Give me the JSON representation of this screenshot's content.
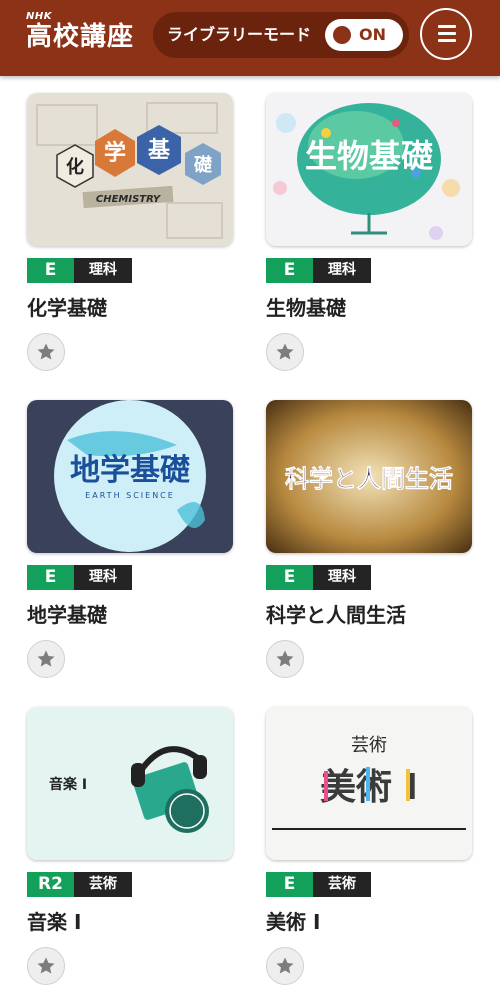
{
  "header": {
    "logo_small": "NHK",
    "logo_name": "高校講座",
    "mode_label": "ライブラリーモード",
    "toggle_state": "ON",
    "menu_icon": "hamburger-menu-icon"
  },
  "colors": {
    "header_bg": "#8c3216",
    "channel_badge": "#12a05a",
    "subject_badge": "#242424"
  },
  "programs": [
    {
      "title": "化学基礎",
      "channel": "E",
      "subject": "理科",
      "art_text": "化学基礎",
      "art_sub": "CHEMISTRY",
      "favorite_icon": "star-icon"
    },
    {
      "title": "生物基礎",
      "channel": "E",
      "subject": "理科",
      "art_text": "生物基礎",
      "favorite_icon": "star-icon"
    },
    {
      "title": "地学基礎",
      "channel": "E",
      "subject": "理科",
      "art_text": "地学基礎",
      "art_sub": "EARTH SCIENCE",
      "favorite_icon": "star-icon"
    },
    {
      "title": "科学と人間生活",
      "channel": "E",
      "subject": "理科",
      "art_text": "科学と人間生活",
      "favorite_icon": "star-icon"
    },
    {
      "title": "音楽 I",
      "channel": "R2",
      "subject": "芸術",
      "art_text": "音楽 I",
      "favorite_icon": "star-icon"
    },
    {
      "title": "美術 I",
      "channel": "E",
      "subject": "芸術",
      "art_text": "美術 I",
      "art_small": "芸術",
      "favorite_icon": "star-icon"
    }
  ]
}
